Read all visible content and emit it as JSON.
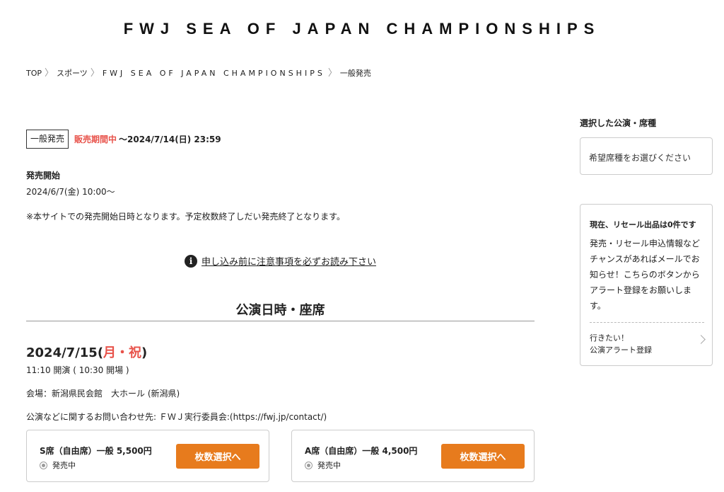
{
  "site": {
    "title": "FWJ SEA OF JAPAN CHAMPIONSHIPS"
  },
  "breadcrumb": {
    "items": [
      "TOP",
      "スポーツ",
      "FWJ SEA OF JAPAN CHAMPIONSHIPS",
      "一般発売"
    ]
  },
  "sale": {
    "badge": "一般発売",
    "status": "販売期間中",
    "until": "〜2024/7/14(日) 23:59",
    "release_label": "発売開始",
    "release_date": "2024/6/7(金) 10:00〜",
    "note": "※本サイトでの発売開始日時となります。予定枚数終了しだい発売終了となります。",
    "notice_link": "申し込み前に注意事項を必ずお読み下さい",
    "notice_icon": "info-icon"
  },
  "performance": {
    "section_title": "公演日時・座席",
    "date_main": "2024/7/15(",
    "date_holiday": "月・祝",
    "date_close": ")",
    "time": "11:10 開演 ( 10:30 開場 )",
    "venue": "会場：新潟県民会館　大ホール (新潟県)",
    "contact": "公演などに関するお問い合わせ先: ＦＷＪ実行委員会:(https://fwj.jp/contact/)",
    "seats": [
      {
        "name": "S席（自由席）一般 5,500円",
        "status": "発売中",
        "button": "枚数選択へ"
      },
      {
        "name": "A席（自由席）一般 4,500円",
        "status": "発売中",
        "button": "枚数選択へ"
      }
    ]
  },
  "sidebar": {
    "selected_title": "選択した公演・席種",
    "selected_placeholder": "希望席種をお選びください",
    "resale_title": "現在、リセール出品は0件です",
    "resale_body": "発売・リセール申込情報などチャンスがあればメールでお知らせ！こちらのボタンからアラート登録をお願いします。",
    "alert_line1": "行きたい！",
    "alert_line2": "公演アラート登録"
  },
  "colors": {
    "accent_orange": "#e77b1d",
    "status_red": "#e8524a"
  }
}
